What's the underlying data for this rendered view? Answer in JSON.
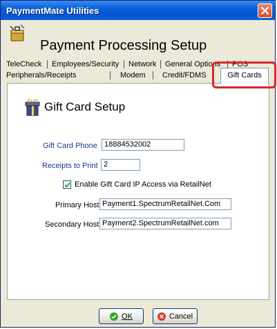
{
  "window": {
    "title": "PaymentMate Utilities"
  },
  "header": {
    "title": "Payment Processing Setup"
  },
  "tabs": {
    "row1": [
      "TeleCheck",
      "Employees/Security",
      "Network",
      "General Options",
      "POS"
    ],
    "row2": [
      "Peripherals/Receipts",
      "Modem",
      "Credit/FDMS"
    ],
    "active": "Gift Cards"
  },
  "section": {
    "title": "Gift Card Setup"
  },
  "form": {
    "gift_card_phone_label": "Gift Card Phone",
    "gift_card_phone_value": "18884532002",
    "receipts_label": "Receipts to Print",
    "receipts_value": "2",
    "enable_ip_label": "Enable Gift Card IP Access via RetailNet",
    "enable_ip_checked": true,
    "primary_host_label": "Primary Host",
    "primary_host_value": "Payment1.SpectrumRetailNet.Com",
    "secondary_host_label": "Secondary Host",
    "secondary_host_value": "Payment2.SpectrumRetailNet.com"
  },
  "buttons": {
    "ok_label": "OK",
    "cancel_label": "Cancel"
  },
  "colors": {
    "titlebar": "#0a5fd8",
    "highlight": "#d9262b",
    "label_blue": "#1b3a8a"
  },
  "icons": [
    "toolbox-icon",
    "gift-card-icon",
    "close-icon",
    "check-icon",
    "cancel-icon"
  ]
}
